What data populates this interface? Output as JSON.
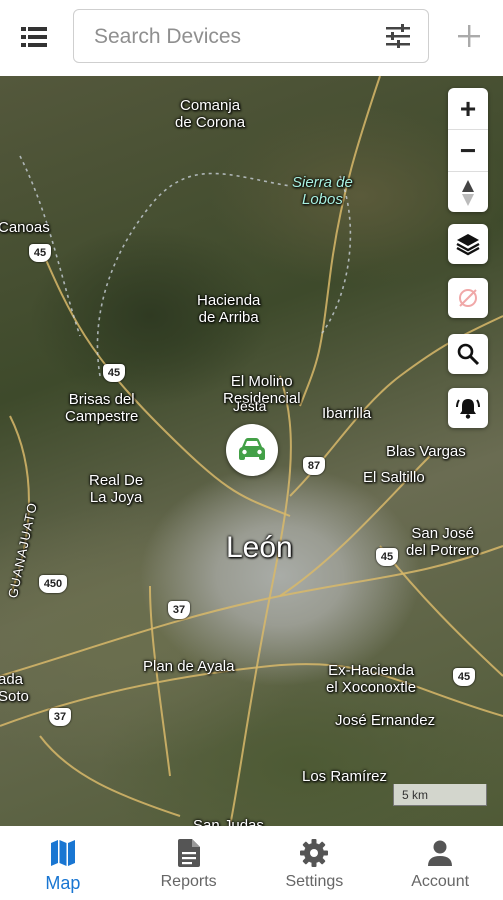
{
  "topbar": {
    "search_placeholder": "Search Devices"
  },
  "map": {
    "places": [
      {
        "id": "comanja",
        "text": "Comanja\nde Corona"
      },
      {
        "id": "sierra",
        "text": "Sierra de\nLobos"
      },
      {
        "id": "canoas",
        "text": "Canoas"
      },
      {
        "id": "hacienda-arriba",
        "text": "Hacienda\nde Arriba"
      },
      {
        "id": "el-molino",
        "text": "El Molino\nResidencial"
      },
      {
        "id": "jesta",
        "text": "Jesta"
      },
      {
        "id": "brisas",
        "text": "Brisas del\nCampestre"
      },
      {
        "id": "ibarrilla",
        "text": "Ibarrilla"
      },
      {
        "id": "blas-vargas",
        "text": "Blas Vargas"
      },
      {
        "id": "el-saltillo",
        "text": "El Saltillo"
      },
      {
        "id": "real-de-la-joya",
        "text": "Real De\nLa Joya"
      },
      {
        "id": "leon",
        "text": "León"
      },
      {
        "id": "san-jose",
        "text": "San José\ndel Potrero"
      },
      {
        "id": "guanajuato",
        "text": "GUANAJUATO"
      },
      {
        "id": "plan-de-ayala",
        "text": "Plan de Ayala"
      },
      {
        "id": "ex-hacienda",
        "text": "Ex-Hacienda\nel Xoconoxtle"
      },
      {
        "id": "ada-soto",
        "text": "ada\nSoto"
      },
      {
        "id": "jose-ernandez",
        "text": "José Ernandez"
      },
      {
        "id": "los-ramirez",
        "text": "Los Ramírez"
      },
      {
        "id": "san-judas",
        "text": "San Judas"
      }
    ],
    "shields": [
      "45",
      "45",
      "87",
      "45",
      "450",
      "37",
      "37",
      "45"
    ],
    "controls": {
      "zoom_in": "+",
      "zoom_out": "−"
    },
    "scale": "5 km",
    "vehicle_color": "#43a047"
  },
  "nav": {
    "items": [
      {
        "id": "map",
        "label": "Map",
        "active": true
      },
      {
        "id": "reports",
        "label": "Reports",
        "active": false
      },
      {
        "id": "settings",
        "label": "Settings",
        "active": false
      },
      {
        "id": "account",
        "label": "Account",
        "active": false
      }
    ],
    "active_color": "#1976d2",
    "inactive_color": "#555555"
  }
}
